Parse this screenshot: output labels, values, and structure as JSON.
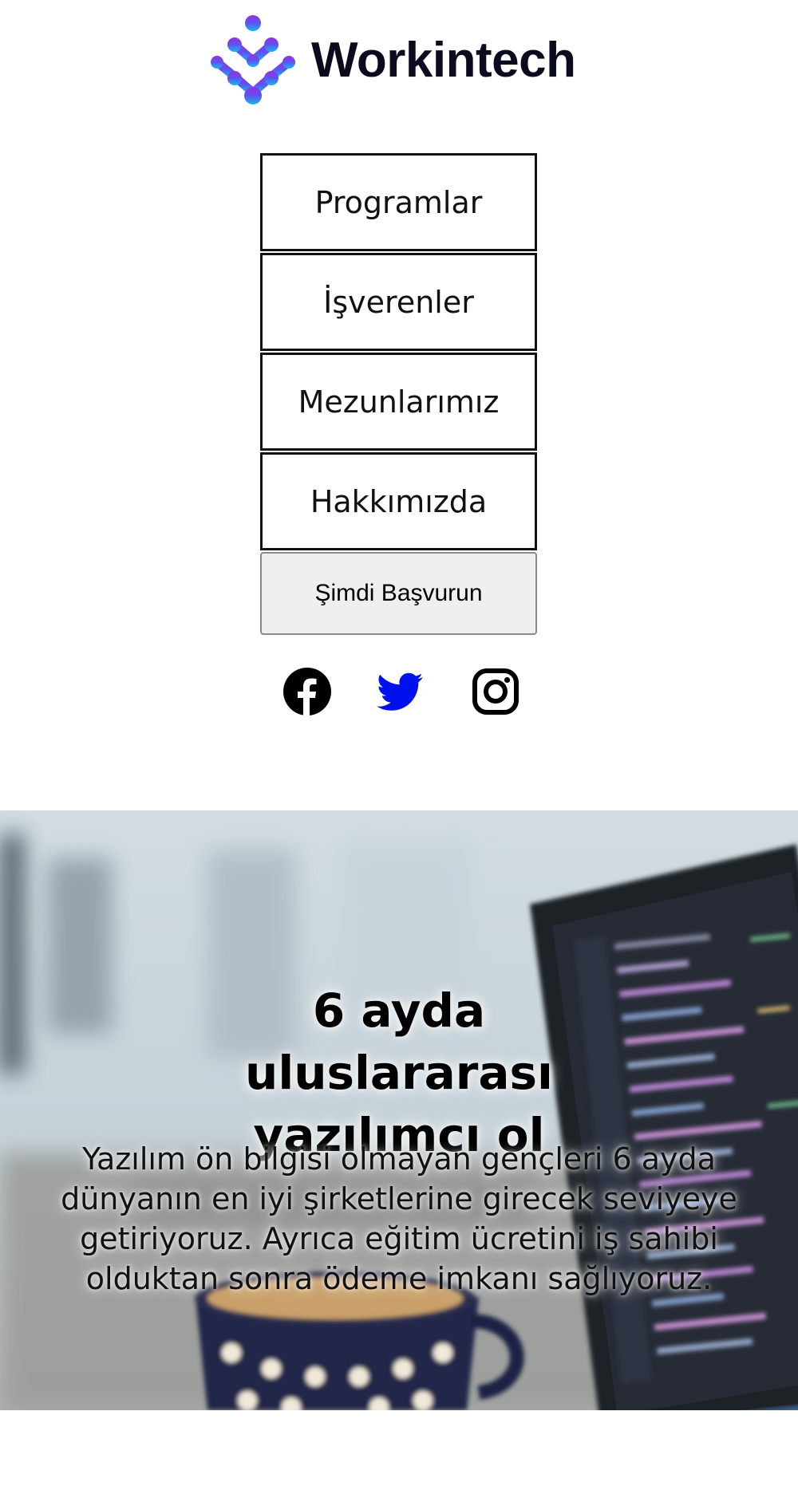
{
  "brand": {
    "name": "Workintech",
    "logo_icon": "workintech-logo-icon"
  },
  "nav": {
    "items": [
      {
        "label": "Programlar"
      },
      {
        "label": "İşverenler"
      },
      {
        "label": "Mezunlarımız"
      },
      {
        "label": "Hakkımızda"
      }
    ],
    "apply_label": "Şimdi Başvurun"
  },
  "social": {
    "icons": [
      "facebook-icon",
      "twitter-icon",
      "instagram-icon"
    ],
    "colors": {
      "facebook": "#000000",
      "twitter": "#0011ee",
      "instagram": "#000000"
    }
  },
  "hero": {
    "title": "6 ayda uluslararası yazılımcı ol",
    "description": "Yazılım ön bilgisi olmayan gençleri 6 ayda dünyanın en iyi şirketlerine girecek seviyeye getiriyoruz. Ayrıca eğitim ücretini iş sahibi olduktan sonra ödeme imkanı sağlıyoruz."
  }
}
